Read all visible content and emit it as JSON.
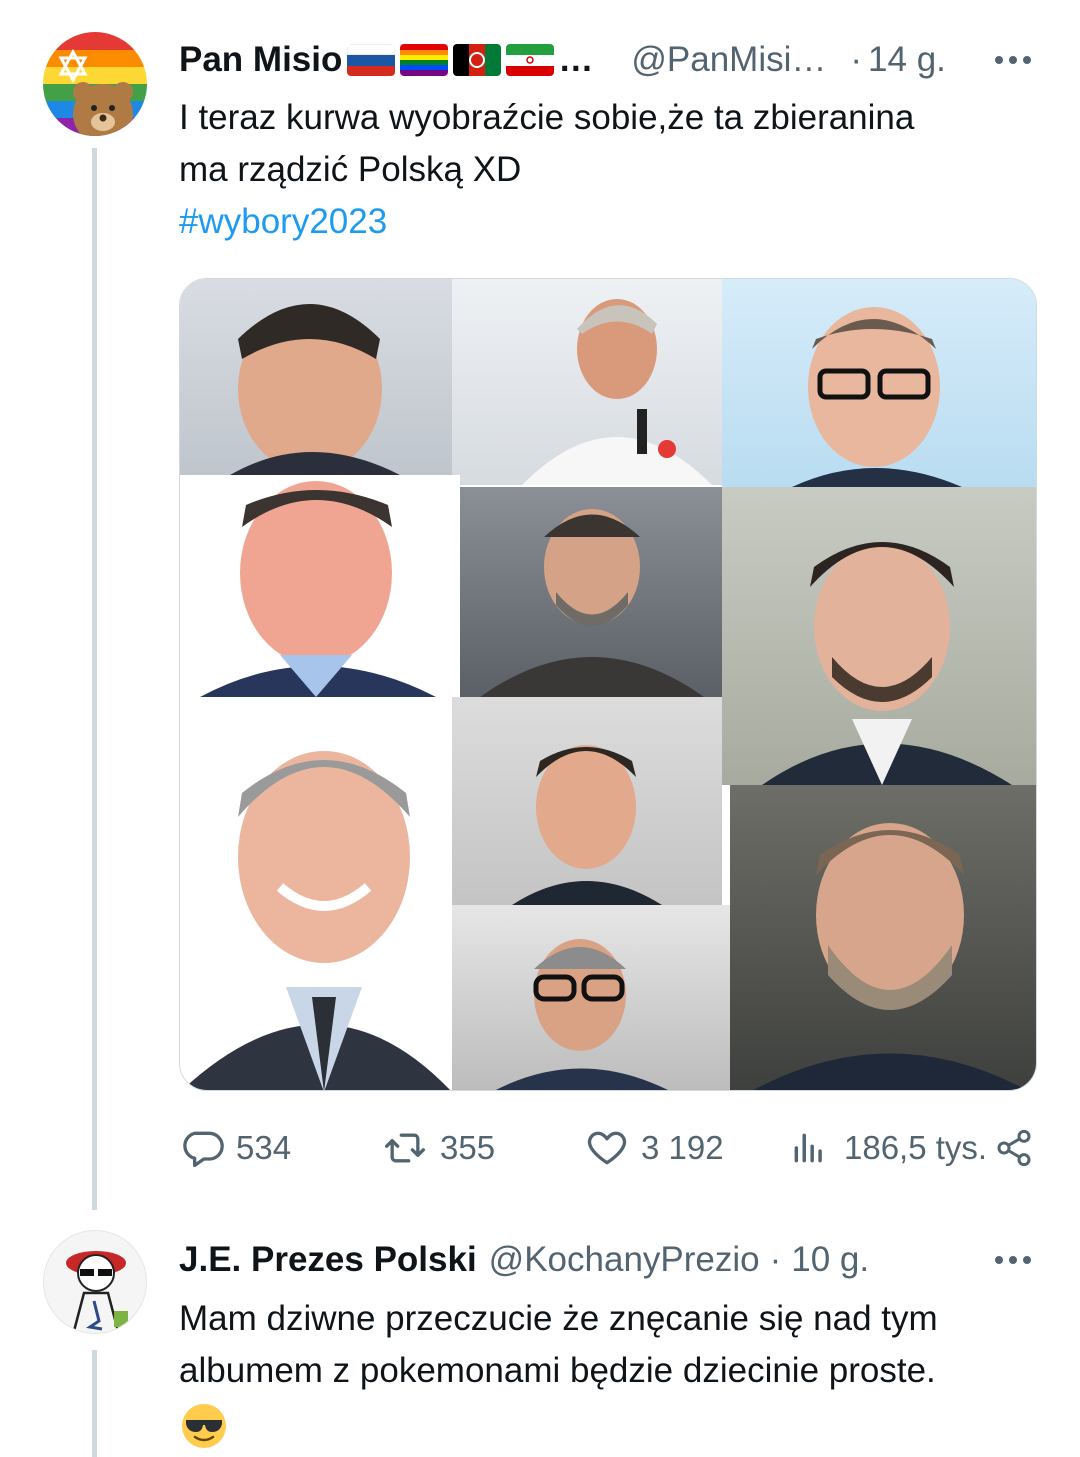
{
  "tweet1": {
    "author_name": "Pan Misio",
    "ellipsis": "…",
    "handle": "@PanMisi…",
    "separator": "·",
    "time": "14 g.",
    "text_line1": "I teraz kurwa wyobraźcie sobie,że ta zbieranina",
    "text_line2": "ma rządzić Polską XD",
    "hashtag": "#wybory2023",
    "flags": [
      "russia-flag",
      "rainbow-flag",
      "afghanistan-flag",
      "iran-flag"
    ],
    "stats": {
      "replies": "534",
      "reposts": "355",
      "likes": "3 192",
      "views": "186,5 tys."
    }
  },
  "tweet2": {
    "author_name": "J.E. Prezes Polski",
    "handle": "@KochanyPrezio",
    "separator": "·",
    "time": "10 g.",
    "text_line1": "Mam dziwne przeczucie że znęcanie się nad tym",
    "text_line2": "albumem z pokemonami będzie dziecinie proste.",
    "emoji": "😎"
  },
  "colors": {
    "text": "#0f1419",
    "secondary": "#536471",
    "link": "#1d9bf0",
    "border": "#cfd9de"
  }
}
